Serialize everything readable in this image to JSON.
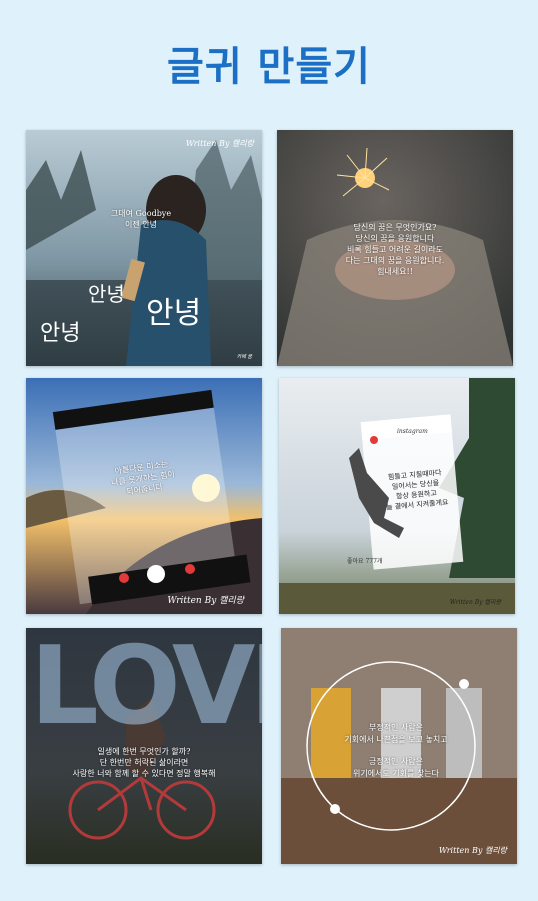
{
  "page": {
    "title": "글귀 만들기"
  },
  "cards": [
    {
      "watermark": "Written By 캘리랑",
      "small_text": "그대여 Goodbye\n이젠 안녕",
      "big_text_1": "안녕",
      "big_text_2": "안녕",
      "big_text_3": "안녕",
      "corner_mark": "카페 꿈"
    },
    {
      "text": "당신의 꿈은 무엇인가요?\n당신의 꿈을 응원합니다\n비록 힘들고 어려운 길이라도\n다는 그대의 꿈을 응원합니다.\n힘내세요!!"
    },
    {
      "text": "아름다운 미소는\n나를 웃게하는 힘이\n되어줍니다",
      "watermark": "Written By 캘리랑"
    },
    {
      "username": "instagram",
      "text": "힘들고 지칠때마다\n일어서는 당신을\n항상 응원하고\n늘 곁에서 지켜줄게요",
      "likes": "좋아요 777개",
      "watermark": "Written By 캘리랑"
    },
    {
      "big_word": "LOVE",
      "text": "일생에 한번 무엇인가 할까?\n단 한번만 허락된 삶이라면\n사랑한 너와 함께 할 수 있다면 정말 행복해"
    },
    {
      "text_1": "부정적인 사람은\n기회에서 나쁜점을 보고 놓치고",
      "text_2": "긍정적인 사람은\n위기에서도 기회를 찾는다",
      "watermark": "Written By 캘리랑"
    }
  ]
}
